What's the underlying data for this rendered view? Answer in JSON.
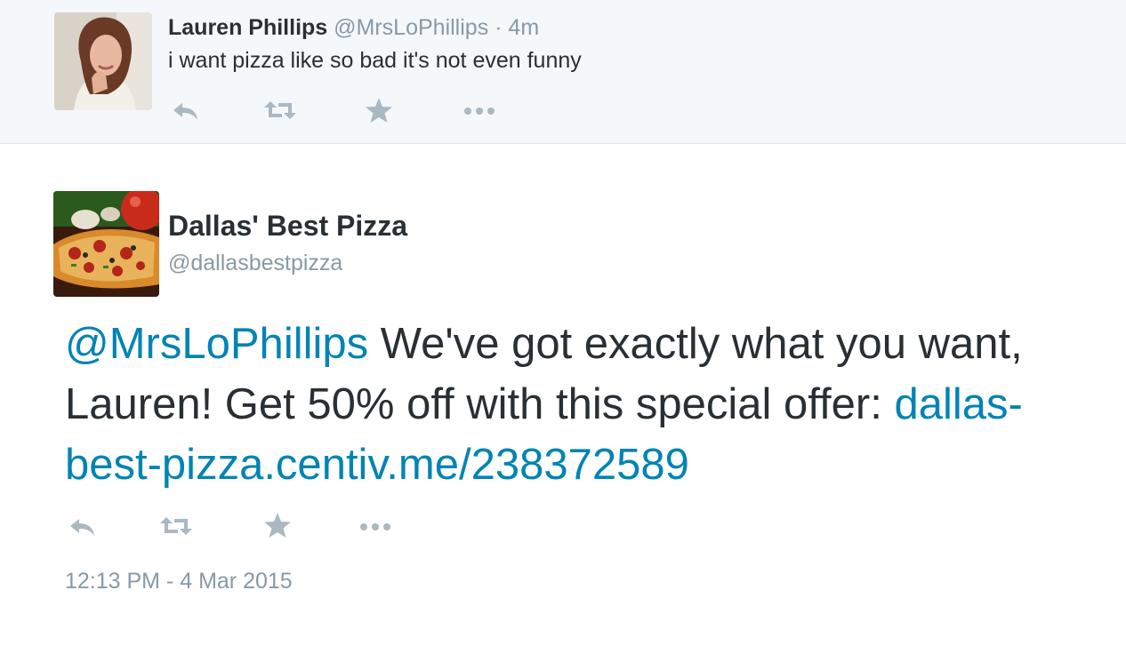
{
  "parent_tweet": {
    "name": "Lauren Phillips",
    "handle": "@MrsLoPhillips",
    "separator": " · ",
    "time": "4m",
    "text": "i want pizza like so bad it's not even funny"
  },
  "main_tweet": {
    "name": "Dallas' Best Pizza",
    "handle": "@dallasbestpizza",
    "mention": "@MrsLoPhillips",
    "text_body": " We've got exactly what you want, Lauren! Get 50% off with this special offer: ",
    "link": "dallas-best-pizza.centiv.me/238372589",
    "timestamp": "12:13 PM - 4 Mar 2015"
  },
  "icons": [
    "reply-icon",
    "retweet-icon",
    "favorite-icon",
    "more-icon"
  ],
  "colors": {
    "link": "#0084b4",
    "text": "#292f33",
    "muted": "#8899a6",
    "icon": "#aab8c2",
    "parent_bg": "#f5f8fa",
    "divider": "#e1e8ed"
  }
}
